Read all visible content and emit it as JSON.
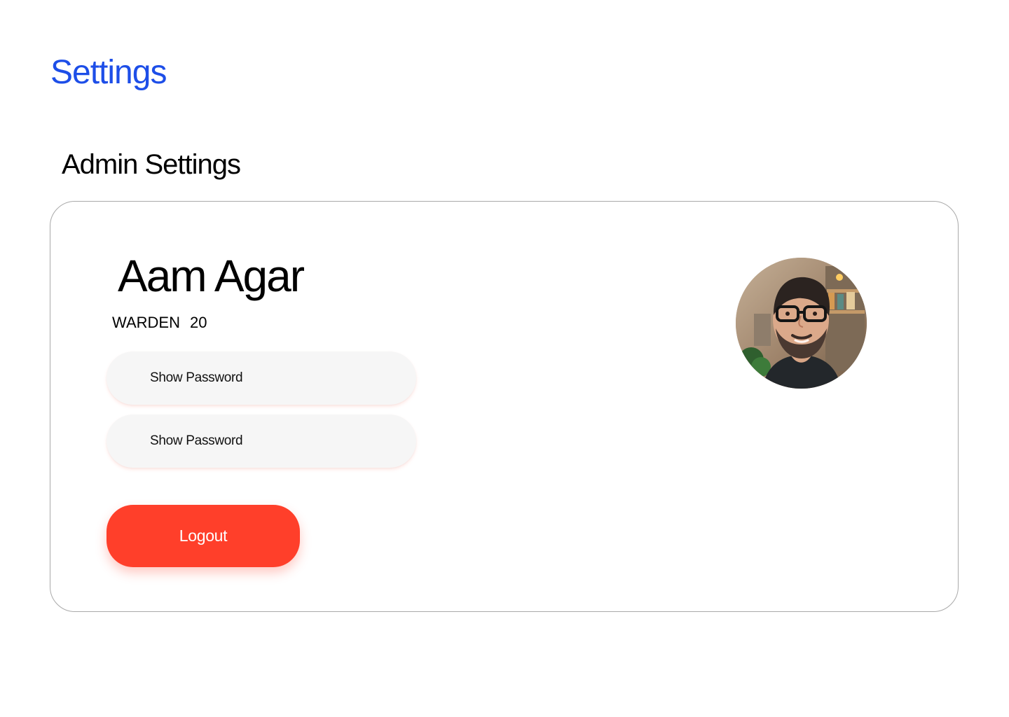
{
  "header": {
    "title": "Settings"
  },
  "section": {
    "title": "Admin Settings"
  },
  "profile": {
    "name": "Aam Agar",
    "role": "WARDEN",
    "number": "20",
    "avatar": "profile-photo"
  },
  "fields": [
    {
      "label": "Show Password"
    },
    {
      "label": "Show Password"
    }
  ],
  "actions": {
    "logout_label": "Logout"
  },
  "colors": {
    "accent": "#1d4ee8",
    "logout": "#ff3f2a",
    "field_bg": "#f6f6f6",
    "card_border": "#a9a9a9"
  }
}
